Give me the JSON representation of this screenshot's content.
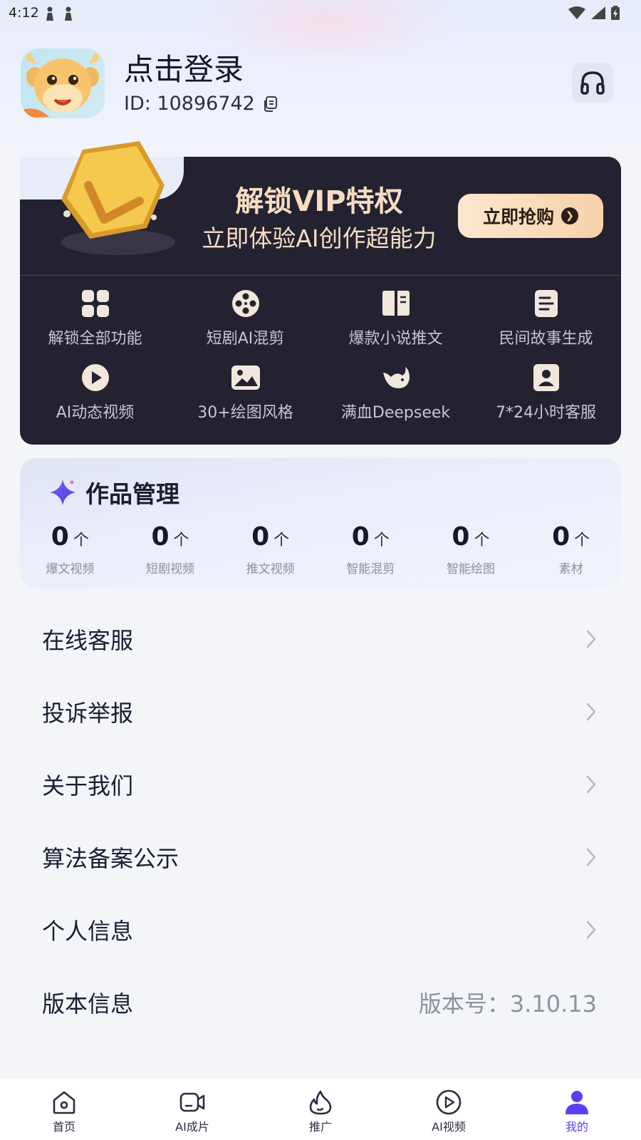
{
  "status_bar": {
    "time": "4:12"
  },
  "profile": {
    "login_text": "点击登录",
    "user_id": "ID: 10896742"
  },
  "vip": {
    "title": "解锁VIP特权",
    "subtitle": "立即体验AI创作超能力",
    "buy_label": "立即抢购",
    "features": [
      {
        "label": "解锁全部功能",
        "icon": "grid-icon"
      },
      {
        "label": "短剧AI混剪",
        "icon": "film-reel-icon"
      },
      {
        "label": "爆款小说推文",
        "icon": "book-icon"
      },
      {
        "label": "民间故事生成",
        "icon": "document-icon"
      },
      {
        "label": "AI动态视频",
        "icon": "play-icon"
      },
      {
        "label": "30+绘图风格",
        "icon": "image-icon"
      },
      {
        "label": "满血Deepseek",
        "icon": "whale-icon"
      },
      {
        "label": "7*24小时客服",
        "icon": "contact-icon"
      }
    ]
  },
  "works": {
    "title": "作品管理",
    "unit": "个",
    "stats": [
      {
        "count": "0",
        "label": "爆文视频"
      },
      {
        "count": "0",
        "label": "短剧视频"
      },
      {
        "count": "0",
        "label": "推文视频"
      },
      {
        "count": "0",
        "label": "智能混剪"
      },
      {
        "count": "0",
        "label": "智能绘图"
      },
      {
        "count": "0",
        "label": "素材"
      }
    ]
  },
  "menu": {
    "items": [
      {
        "label": "在线客服"
      },
      {
        "label": "投诉举报"
      },
      {
        "label": "关于我们"
      },
      {
        "label": "算法备案公示"
      },
      {
        "label": "个人信息"
      }
    ],
    "version_label": "版本信息",
    "version_value": "版本号：3.10.13"
  },
  "nav": {
    "items": [
      {
        "label": "首页",
        "icon": "home-icon"
      },
      {
        "label": "AI成片",
        "icon": "video-camera-icon"
      },
      {
        "label": "推广",
        "icon": "flame-icon"
      },
      {
        "label": "AI视频",
        "icon": "play-circle-icon"
      },
      {
        "label": "我的",
        "icon": "user-icon"
      }
    ],
    "active_color": "#5b3ff2"
  }
}
